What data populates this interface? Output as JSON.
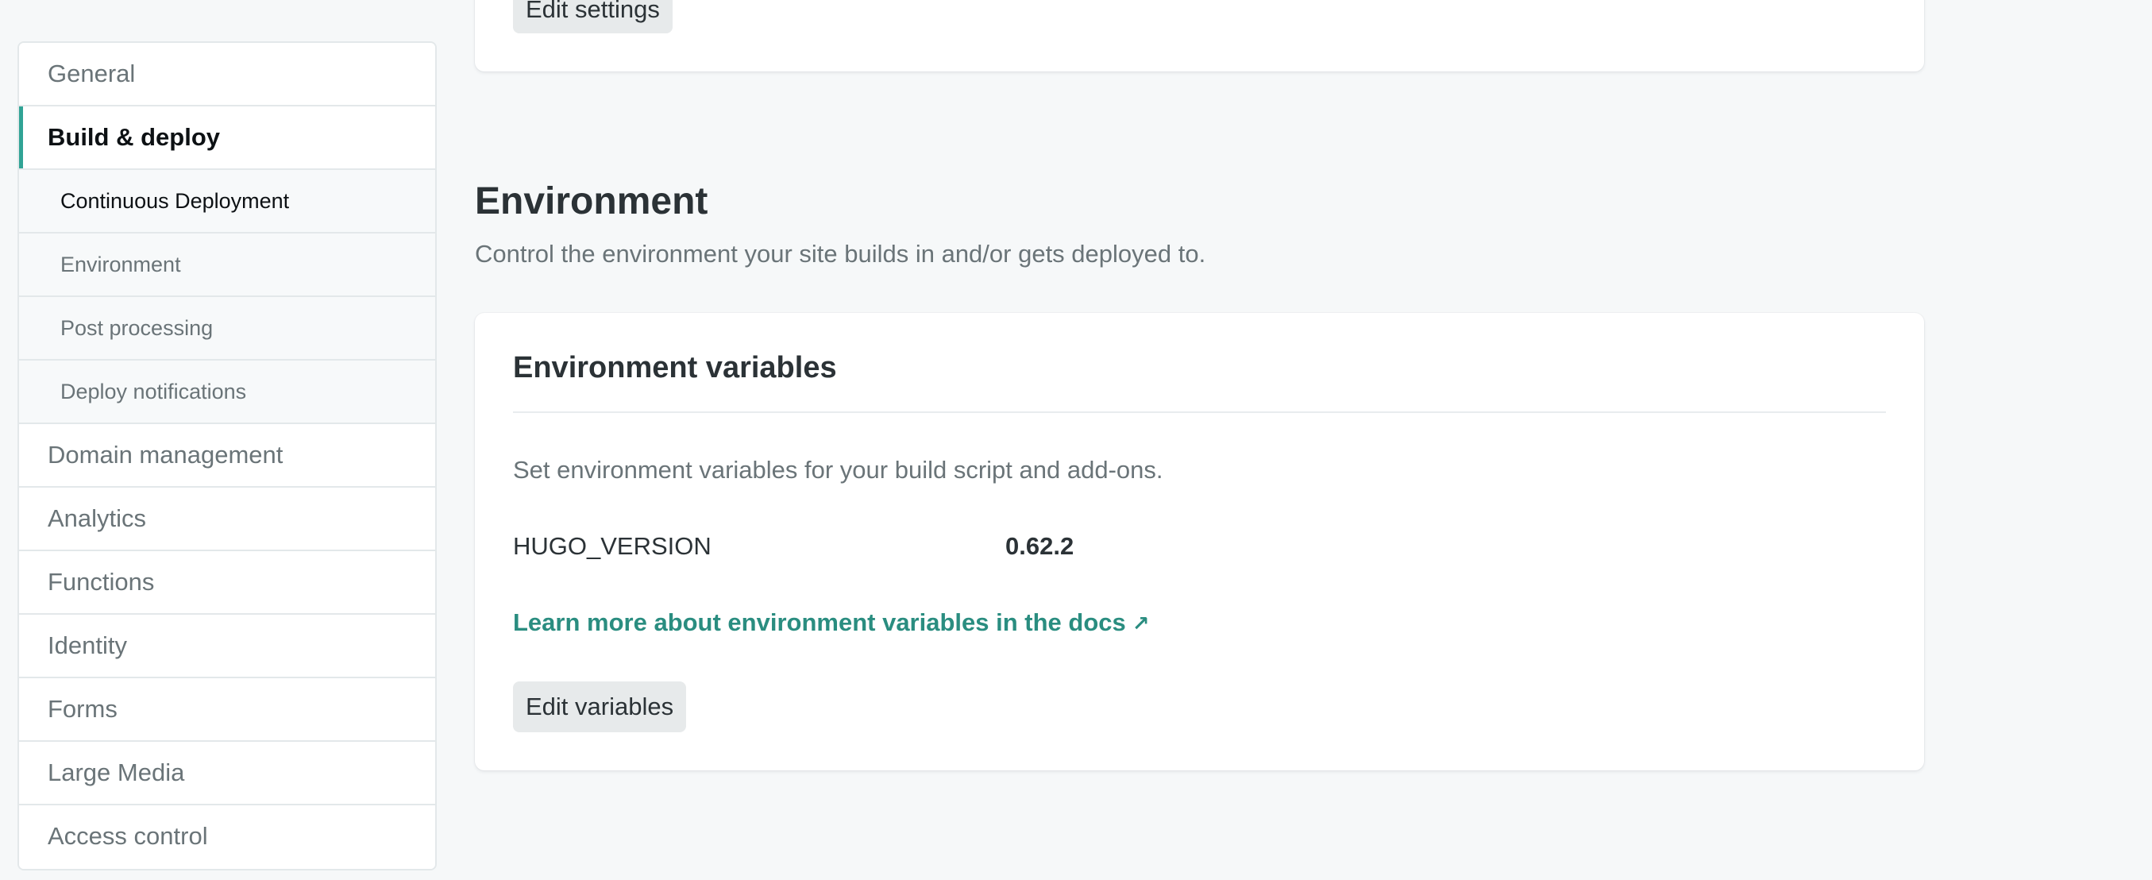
{
  "sidebar": {
    "items": [
      {
        "label": "General"
      },
      {
        "label": "Build & deploy"
      },
      {
        "label": "Domain management"
      },
      {
        "label": "Analytics"
      },
      {
        "label": "Functions"
      },
      {
        "label": "Identity"
      },
      {
        "label": "Forms"
      },
      {
        "label": "Large Media"
      },
      {
        "label": "Access control"
      }
    ],
    "subitems": [
      {
        "label": "Continuous Deployment"
      },
      {
        "label": "Environment"
      },
      {
        "label": "Post processing"
      },
      {
        "label": "Deploy notifications"
      }
    ]
  },
  "top_card": {
    "button_label": "Edit settings"
  },
  "environment": {
    "title": "Environment",
    "description": "Control the environment your site builds in and/or gets deployed to.",
    "card": {
      "title": "Environment variables",
      "description": "Set environment variables for your build script and add-ons.",
      "variables": [
        {
          "key": "HUGO_VERSION",
          "value": "0.62.2"
        }
      ],
      "docs_link": "Learn more about environment variables in the docs",
      "docs_link_icon": "external-link-arrow-icon",
      "button_label": "Edit variables"
    }
  },
  "colors": {
    "accent": "#30a395",
    "link": "#2a8d80",
    "background": "#f6f8f9"
  }
}
